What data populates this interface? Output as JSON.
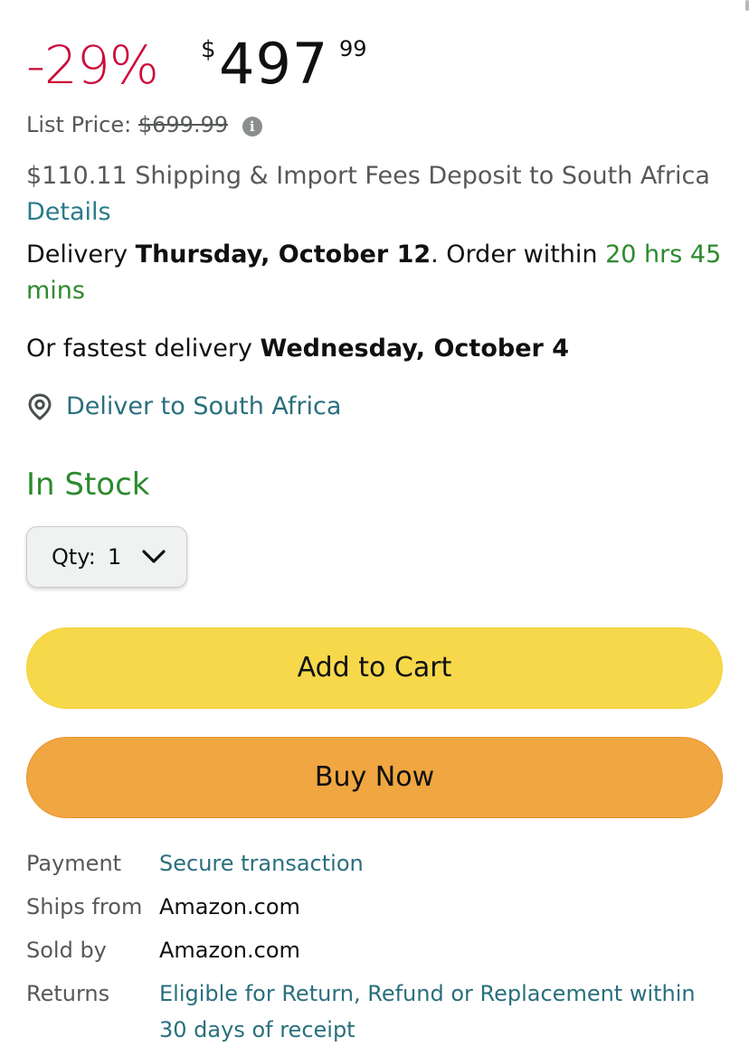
{
  "price": {
    "discount": "-29%",
    "currency": "$",
    "whole": "497",
    "fraction": "99",
    "list_price_label": "List Price:",
    "list_price_value": "$699.99"
  },
  "shipping": {
    "text": "$110.11 Shipping & Import Fees Deposit to South Africa",
    "details_link": "Details"
  },
  "delivery": {
    "prefix": "Delivery",
    "date": "Thursday, October 12",
    "order_within_text": ". Order within",
    "countdown": "20 hrs 45 mins",
    "fastest_prefix": "Or fastest delivery",
    "fastest_date": "Wednesday, October 4"
  },
  "deliver_to": {
    "icon": "location-pin-icon",
    "label": "Deliver to South Africa"
  },
  "stock": {
    "status": "In Stock"
  },
  "quantity": {
    "label": "Qty:",
    "value": "1"
  },
  "buttons": {
    "add_to_cart": "Add to Cart",
    "buy_now": "Buy Now"
  },
  "info": {
    "rows": [
      {
        "key": "Payment",
        "value": "Secure transaction"
      },
      {
        "key": "Ships from",
        "value": "Amazon.com"
      },
      {
        "key": "Sold by",
        "value": "Amazon.com"
      },
      {
        "key": "Returns",
        "value": "Eligible for Return, Refund or Replacement within 30 days of receipt"
      }
    ]
  },
  "colors": {
    "discount": "#cc0c39",
    "link": "#2a6f7d",
    "in_stock": "#2d8a2d",
    "add_to_cart_bg": "#f7d84a",
    "buy_now_bg": "#f0a641"
  }
}
